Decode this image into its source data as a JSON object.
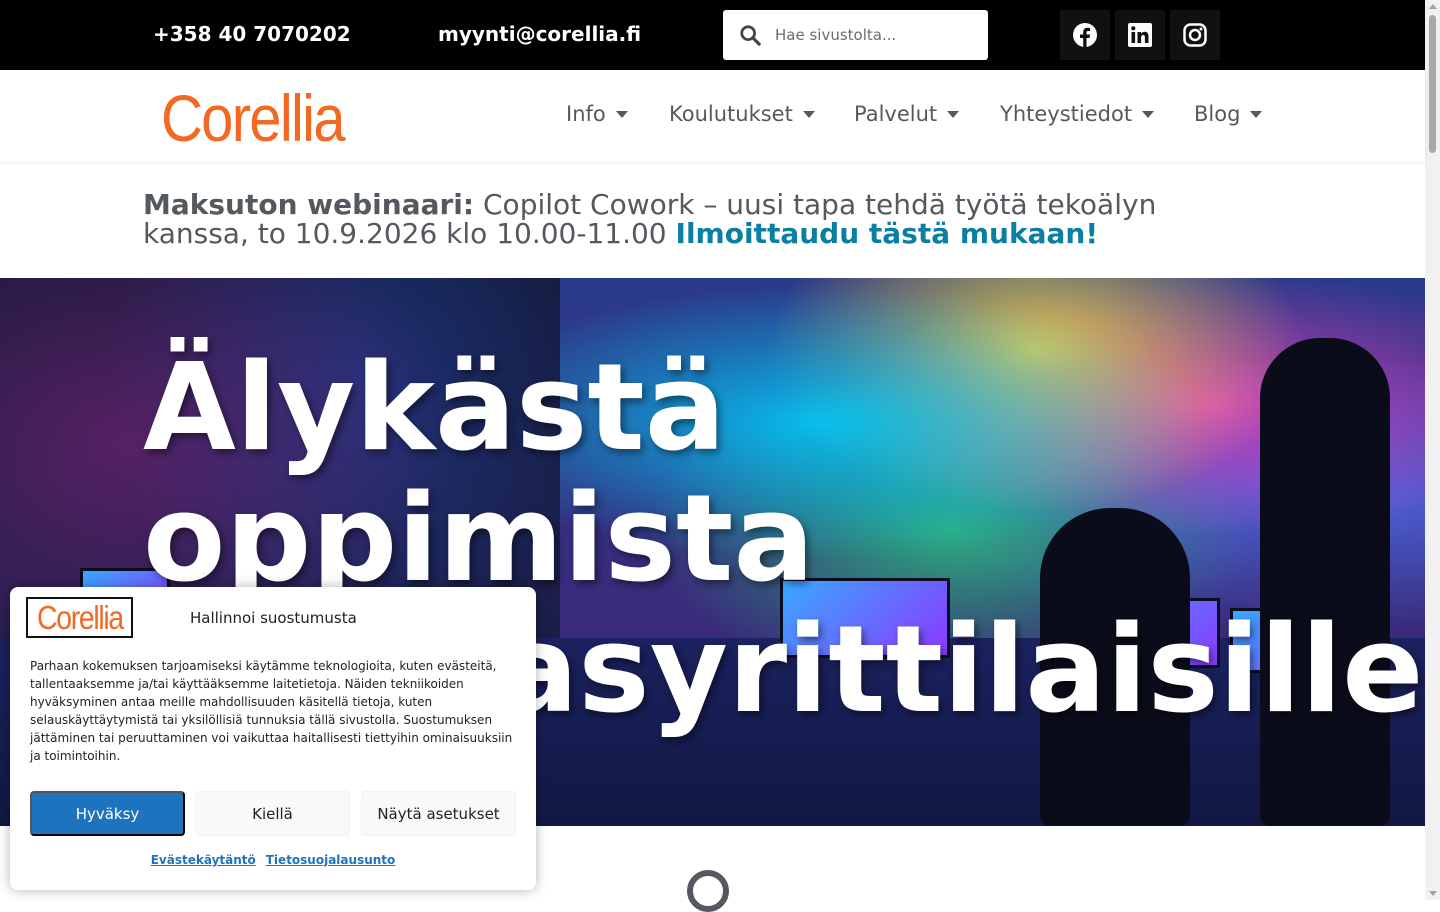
{
  "topbar": {
    "phone": "+358 40 7070202",
    "email": "myynti@corellia.fi",
    "search_placeholder": "Hae sivustolta...",
    "social": [
      "facebook-icon",
      "linkedin-icon",
      "instagram-icon"
    ]
  },
  "header": {
    "logo_text": "Corellia",
    "nav": [
      {
        "label": "Info"
      },
      {
        "label": "Koulutukset"
      },
      {
        "label": "Palvelut"
      },
      {
        "label": "Yhteystiedot"
      },
      {
        "label": "Blog"
      }
    ]
  },
  "announcement": {
    "lead": "Maksuton webinaari:",
    "text": " Copilot Cowork – uusi tapa tehdä työtä tekoälyn kanssa, to 10.9.2026 klo 10.00-11.00 ",
    "link": "Ilmoittaudu tästä mukaan",
    "tail": "!"
  },
  "hero": {
    "headline": "Älykästä oppimista asiakasyrittilaisille."
  },
  "cookie": {
    "logo_text": "Corellia",
    "title": "Hallinnoi suostumusta",
    "body": "Parhaan kokemuksen tarjoamiseksi käytämme teknologioita, kuten evästeitä, tallentaaksemme ja/tai käyttääksemme laitetietoja. Näiden tekniikoiden hyväksyminen antaa meille mahdollisuuden käsitellä tietoja, kuten selauskäyttäytymistä tai yksilöllisiä tunnuksia tällä sivustolla. Suostumuksen jättäminen tai peruuttaminen voi vaikuttaa haitallisesti tiettyihin ominaisuuksiin ja toimintoihin.",
    "accept": "Hyväksy",
    "deny": "Kiellä",
    "preferences": "Näytä asetukset",
    "link_cookies": "Evästekäytäntö",
    "link_privacy": "Tietosuojalausunto"
  },
  "colors": {
    "brand_orange": "#f26a21",
    "link_teal": "#0b7ea3",
    "button_blue": "#1e73be",
    "text_gray": "#54595f"
  }
}
